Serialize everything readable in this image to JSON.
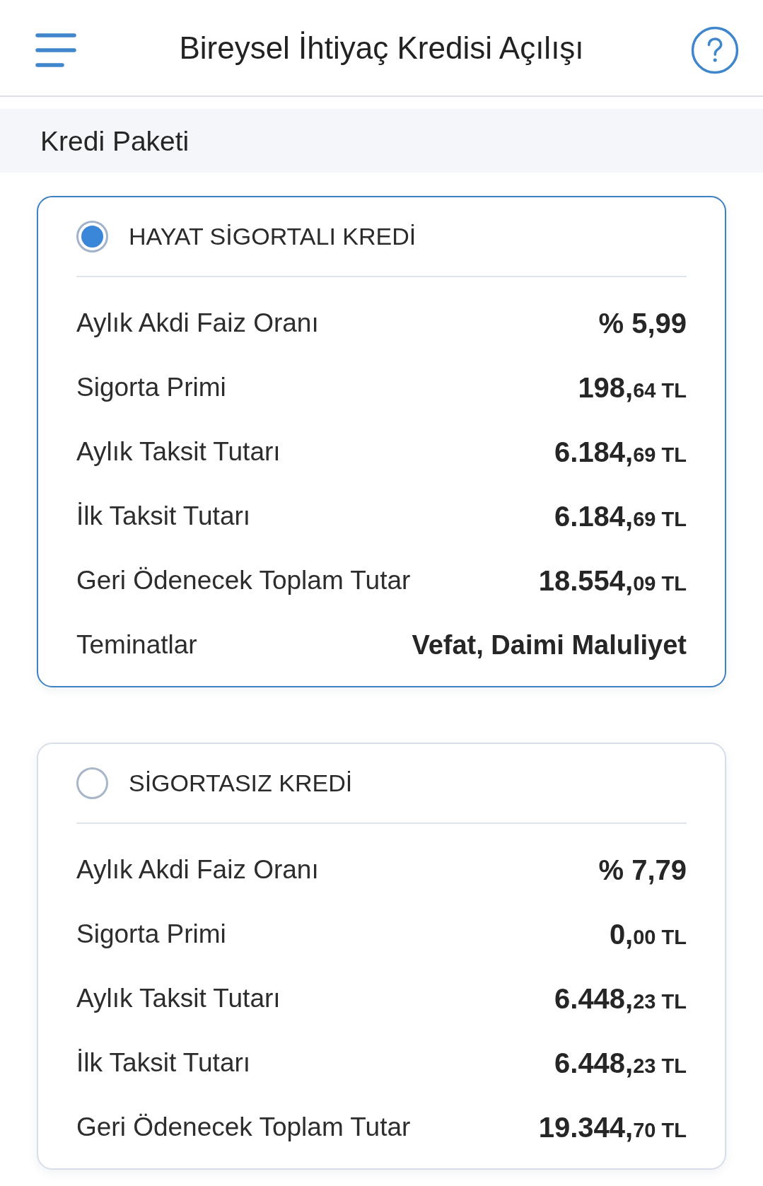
{
  "header": {
    "title": "Bireysel İhtiyaç Kredisi Açılışı"
  },
  "section": {
    "title": "Kredi Paketi"
  },
  "packages": [
    {
      "name": "HAYAT SİGORTALI KREDİ",
      "selected": true,
      "rows": [
        {
          "kind": "rate",
          "label": "Aylık Akdi Faiz Oranı",
          "value": "% 5,99"
        },
        {
          "kind": "amount",
          "label": "Sigorta Primi",
          "whole": "198,",
          "fraction": "64",
          "currency": "TL"
        },
        {
          "kind": "amount",
          "label": "Aylık Taksit Tutarı",
          "whole": "6.184,",
          "fraction": "69",
          "currency": "TL"
        },
        {
          "kind": "amount",
          "label": "İlk Taksit Tutarı",
          "whole": "6.184,",
          "fraction": "69",
          "currency": "TL"
        },
        {
          "kind": "amount",
          "label": "Geri Ödenecek Toplam Tutar",
          "whole": "18.554,",
          "fraction": "09",
          "currency": "TL"
        },
        {
          "kind": "text",
          "label": "Teminatlar",
          "value": "Vefat, Daimi Maluliyet"
        }
      ]
    },
    {
      "name": "SİGORTASIZ KREDİ",
      "selected": false,
      "rows": [
        {
          "kind": "rate",
          "label": "Aylık Akdi Faiz Oranı",
          "value": "% 7,79"
        },
        {
          "kind": "amount",
          "label": "Sigorta Primi",
          "whole": "0,",
          "fraction": "00",
          "currency": "TL"
        },
        {
          "kind": "amount",
          "label": "Aylık Taksit Tutarı",
          "whole": "6.448,",
          "fraction": "23",
          "currency": "TL"
        },
        {
          "kind": "amount",
          "label": "İlk Taksit Tutarı",
          "whole": "6.448,",
          "fraction": "23",
          "currency": "TL"
        },
        {
          "kind": "amount",
          "label": "Geri Ödenecek Toplam Tutar",
          "whole": "19.344,",
          "fraction": "70",
          "currency": "TL"
        }
      ]
    }
  ]
}
